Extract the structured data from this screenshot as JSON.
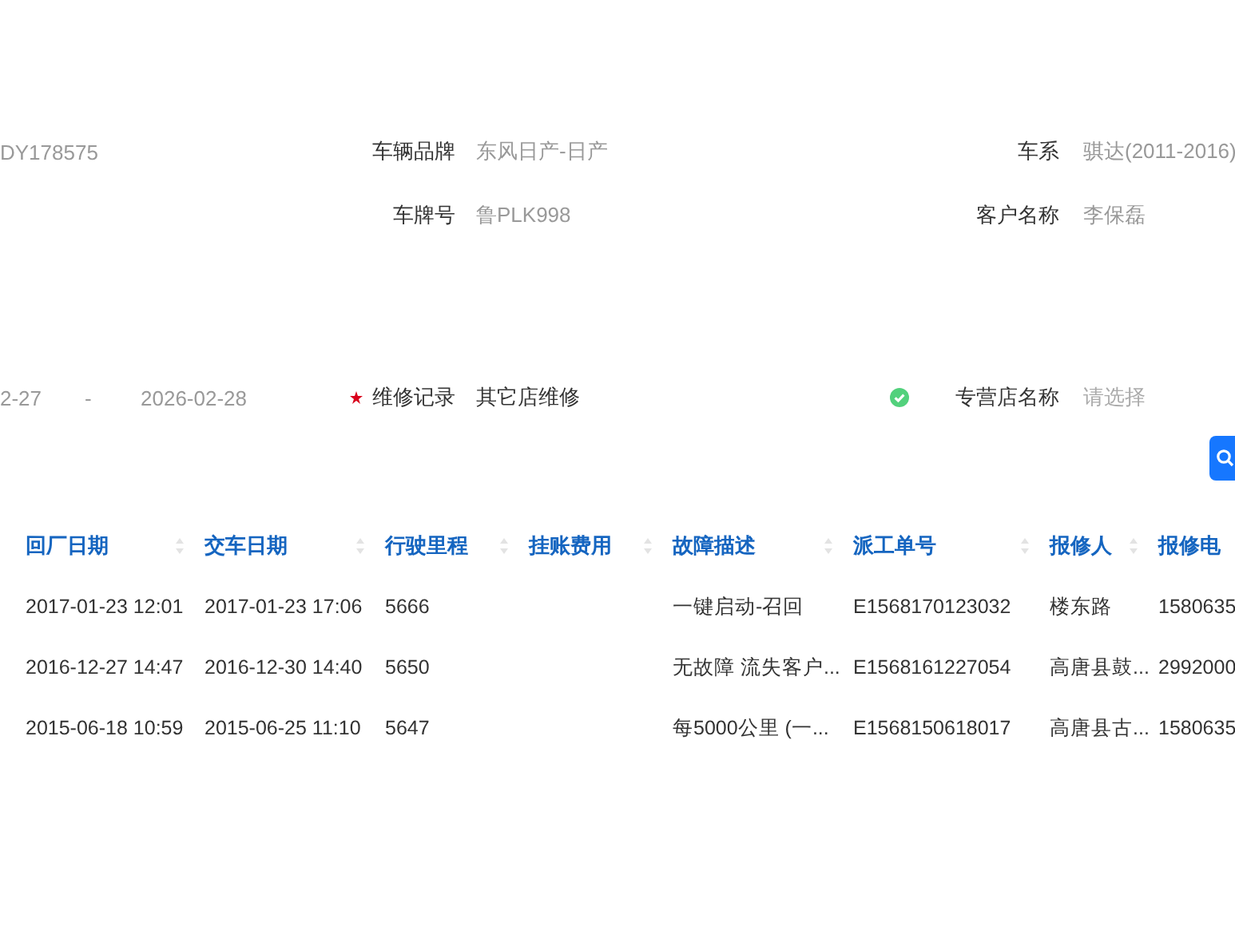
{
  "vehicle": {
    "code": "DY178575",
    "brand": {
      "label": "车辆品牌",
      "value": "东风日产-日产"
    },
    "series": {
      "label": "车系",
      "value": "骐达(2011-2016)"
    },
    "plate": {
      "label": "车牌号",
      "value": "鲁PLK998"
    },
    "customer": {
      "label": "客户名称",
      "value": "李保磊"
    }
  },
  "filters": {
    "date_start": "2-27",
    "date_separator": "-",
    "date_end": "2026-02-28",
    "repair_record": {
      "label": "维修记录",
      "required": true,
      "value": "其它店维修"
    },
    "dealer": {
      "label": "专营店名称",
      "placeholder": "请选择",
      "verified": true
    }
  },
  "table": {
    "columns": [
      "回厂日期",
      "交车日期",
      "行驶里程",
      "挂账费用",
      "故障描述",
      "派工单号",
      "报修人",
      "报修电"
    ],
    "rows": [
      [
        "2017-01-23 12:01",
        "2017-01-23 17:06",
        "5666",
        null,
        "一键启动-召回",
        "E1568170123032",
        "楼东路",
        "1580635"
      ],
      [
        "2016-12-27 14:47",
        "2016-12-30 14:40",
        "5650",
        null,
        "无故障 流失客户...",
        "E1568161227054",
        "高唐县鼓...",
        "2992000"
      ],
      [
        "2015-06-18 10:59",
        "2015-06-25 11:10",
        "5647",
        null,
        "每5000公里 (一...",
        "E1568150618017",
        "高唐县古...",
        "1580635"
      ]
    ]
  }
}
